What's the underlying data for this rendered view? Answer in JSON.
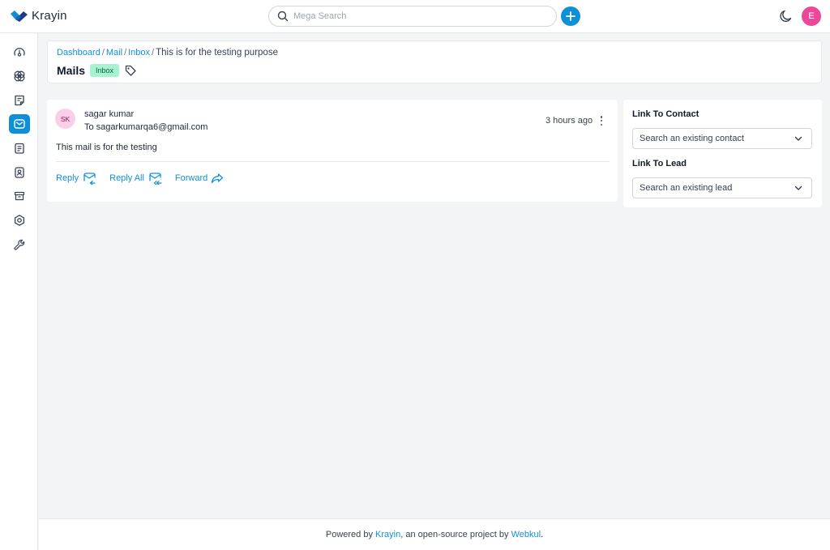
{
  "app": {
    "name": "Krayin"
  },
  "header": {
    "search": {
      "placeholder": "Mega Search"
    },
    "user_initial": "E"
  },
  "sidebar": {
    "items": [
      {
        "name": "dashboard",
        "icon": "gauge-icon",
        "active": false
      },
      {
        "name": "leads",
        "icon": "filter-icon",
        "active": false
      },
      {
        "name": "quotes",
        "icon": "note-icon",
        "active": false
      },
      {
        "name": "mail",
        "icon": "mail-icon",
        "active": true
      },
      {
        "name": "activities",
        "icon": "clipboard-icon",
        "active": false
      },
      {
        "name": "contacts",
        "icon": "contact-icon",
        "active": false
      },
      {
        "name": "products",
        "icon": "box-icon",
        "active": false
      },
      {
        "name": "settings",
        "icon": "gear-icon",
        "active": false
      },
      {
        "name": "configuration",
        "icon": "wrench-icon",
        "active": false
      }
    ]
  },
  "breadcrumb": {
    "items": [
      "Dashboard",
      "Mail",
      "Inbox"
    ],
    "current": "This is for the testing purpose"
  },
  "page": {
    "title": "Mails",
    "badge": "Inbox"
  },
  "mail": {
    "avatar_initials": "SK",
    "sender": "sagar kumar",
    "to": "To sagarkumarqa6@gmail.com",
    "time": "3 hours ago",
    "body": "This mail is for the testing",
    "actions": {
      "reply": "Reply",
      "reply_all": "Reply All",
      "forward": "Forward"
    }
  },
  "link_panel": {
    "contact_label": "Link To Contact",
    "contact_placeholder": "Search an existing contact",
    "lead_label": "Link To Lead",
    "lead_placeholder": "Search an existing lead"
  },
  "footer": {
    "prefix": "Powered by ",
    "krayin": "Krayin",
    "middle": ", an open-source project by ",
    "webkul": "Webkul",
    "suffix": "."
  },
  "colors": {
    "accent": "#0e90d9",
    "badge_bg": "#a7f3d0",
    "avatar": "#ec4899"
  }
}
